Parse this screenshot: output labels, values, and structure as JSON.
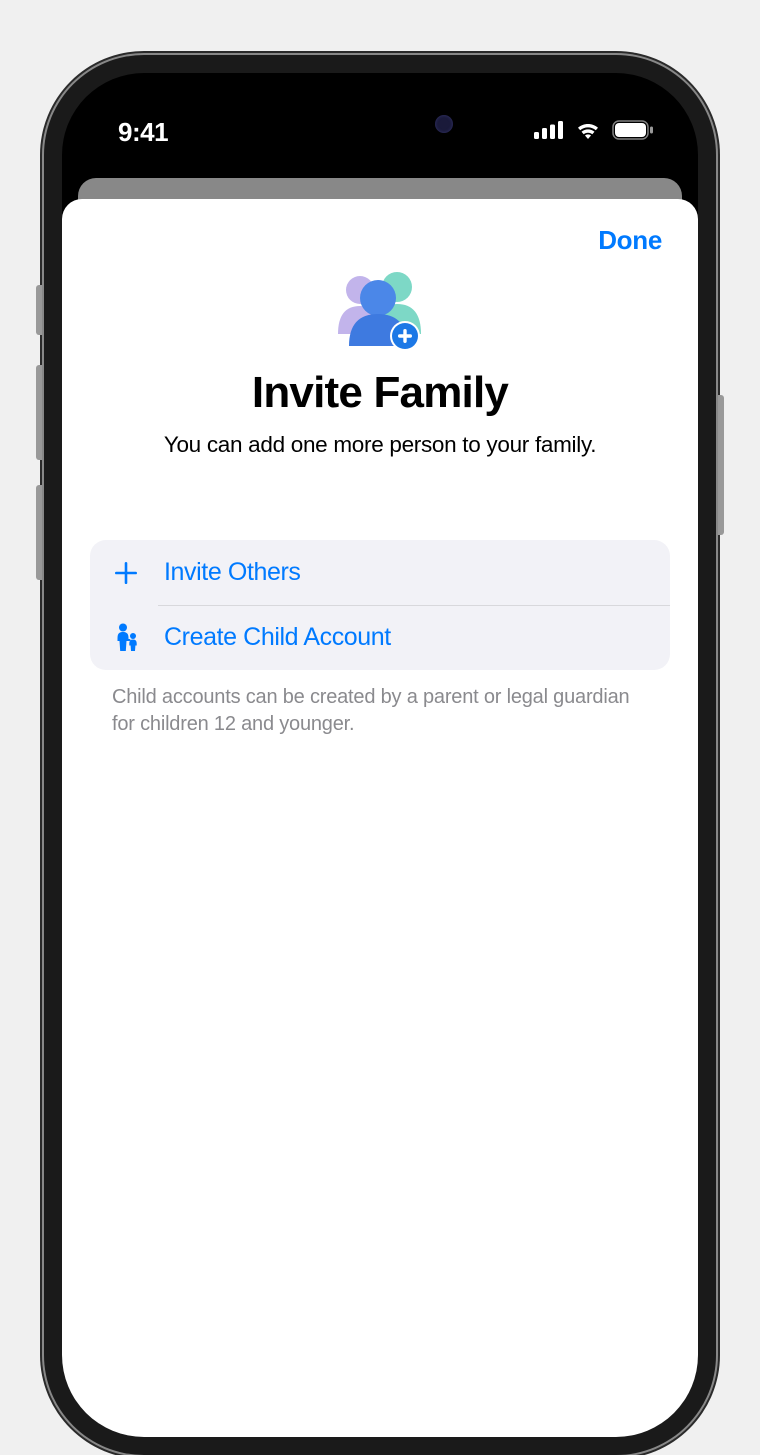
{
  "status": {
    "time": "9:41"
  },
  "nav": {
    "done_label": "Done"
  },
  "hero": {
    "title": "Invite Family",
    "subtitle": "You can add one more person to your family."
  },
  "options": {
    "invite_label": "Invite Others",
    "child_label": "Create Child Account"
  },
  "footer": {
    "note": "Child accounts can be created by a parent or legal guardian for children 12 and younger."
  },
  "colors": {
    "accent": "#007aff"
  }
}
